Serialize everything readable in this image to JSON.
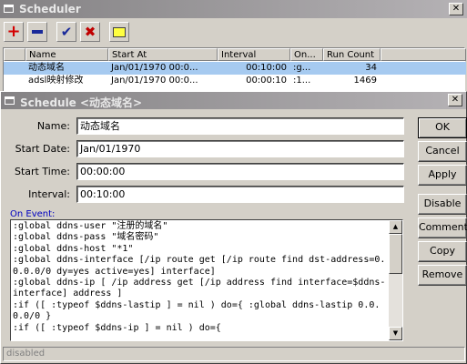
{
  "scheduler": {
    "title": "Scheduler",
    "close_glyph": "✕",
    "columns": [
      "Name",
      "Start At",
      "Interval",
      "On...",
      "Run Count"
    ],
    "rows": [
      {
        "name": "动态域名",
        "start_at": "Jan/01/1970 00:0...",
        "interval": "00:10:00",
        "on": ":g...",
        "run_count": "34"
      },
      {
        "name": "adsl映射修改",
        "start_at": "Jan/01/1970 00:0...",
        "interval": "00:00:10",
        "on": ":1...",
        "run_count": "1469"
      }
    ],
    "toolbar_icons": [
      "plus-icon",
      "minus-icon",
      "check-icon",
      "x-icon",
      "note-icon"
    ]
  },
  "dialog": {
    "title": "Schedule <动态域名>",
    "close_glyph": "✕",
    "fields": {
      "name_label": "Name:",
      "name_value": "动态域名",
      "start_date_label": "Start Date:",
      "start_date_value": "Jan/01/1970",
      "start_time_label": "Start Time:",
      "start_time_value": "00:00:00",
      "interval_label": "Interval:",
      "interval_value": "00:10:00"
    },
    "on_event_label": "On Event:",
    "on_event_script": ":global ddns-user \"注册的域名\"\n:global ddns-pass \"域名密码\"\n:global ddns-host \"*1\"\n:global ddns-interface [/ip route get [/ip route find dst-address=0.0.0.0/0 dy=yes active=yes] interface]\n:global ddns-ip [ /ip address get [/ip address find interface=$ddns-interface] address ]\n:if ([ :typeof $ddns-lastip ] = nil ) do={ :global ddns-lastip 0.0.0.0/0 }\n:if ([ :typeof $ddns-ip ] = nil ) do={",
    "buttons": {
      "ok": "OK",
      "cancel": "Cancel",
      "apply": "Apply",
      "disable": "Disable",
      "comment": "Comment",
      "copy": "Copy",
      "remove": "Remove"
    },
    "status": "disabled"
  },
  "colors": {
    "title_bar": "#848284",
    "selection": "#a6caf0",
    "on_event_label": "#0000c0"
  }
}
